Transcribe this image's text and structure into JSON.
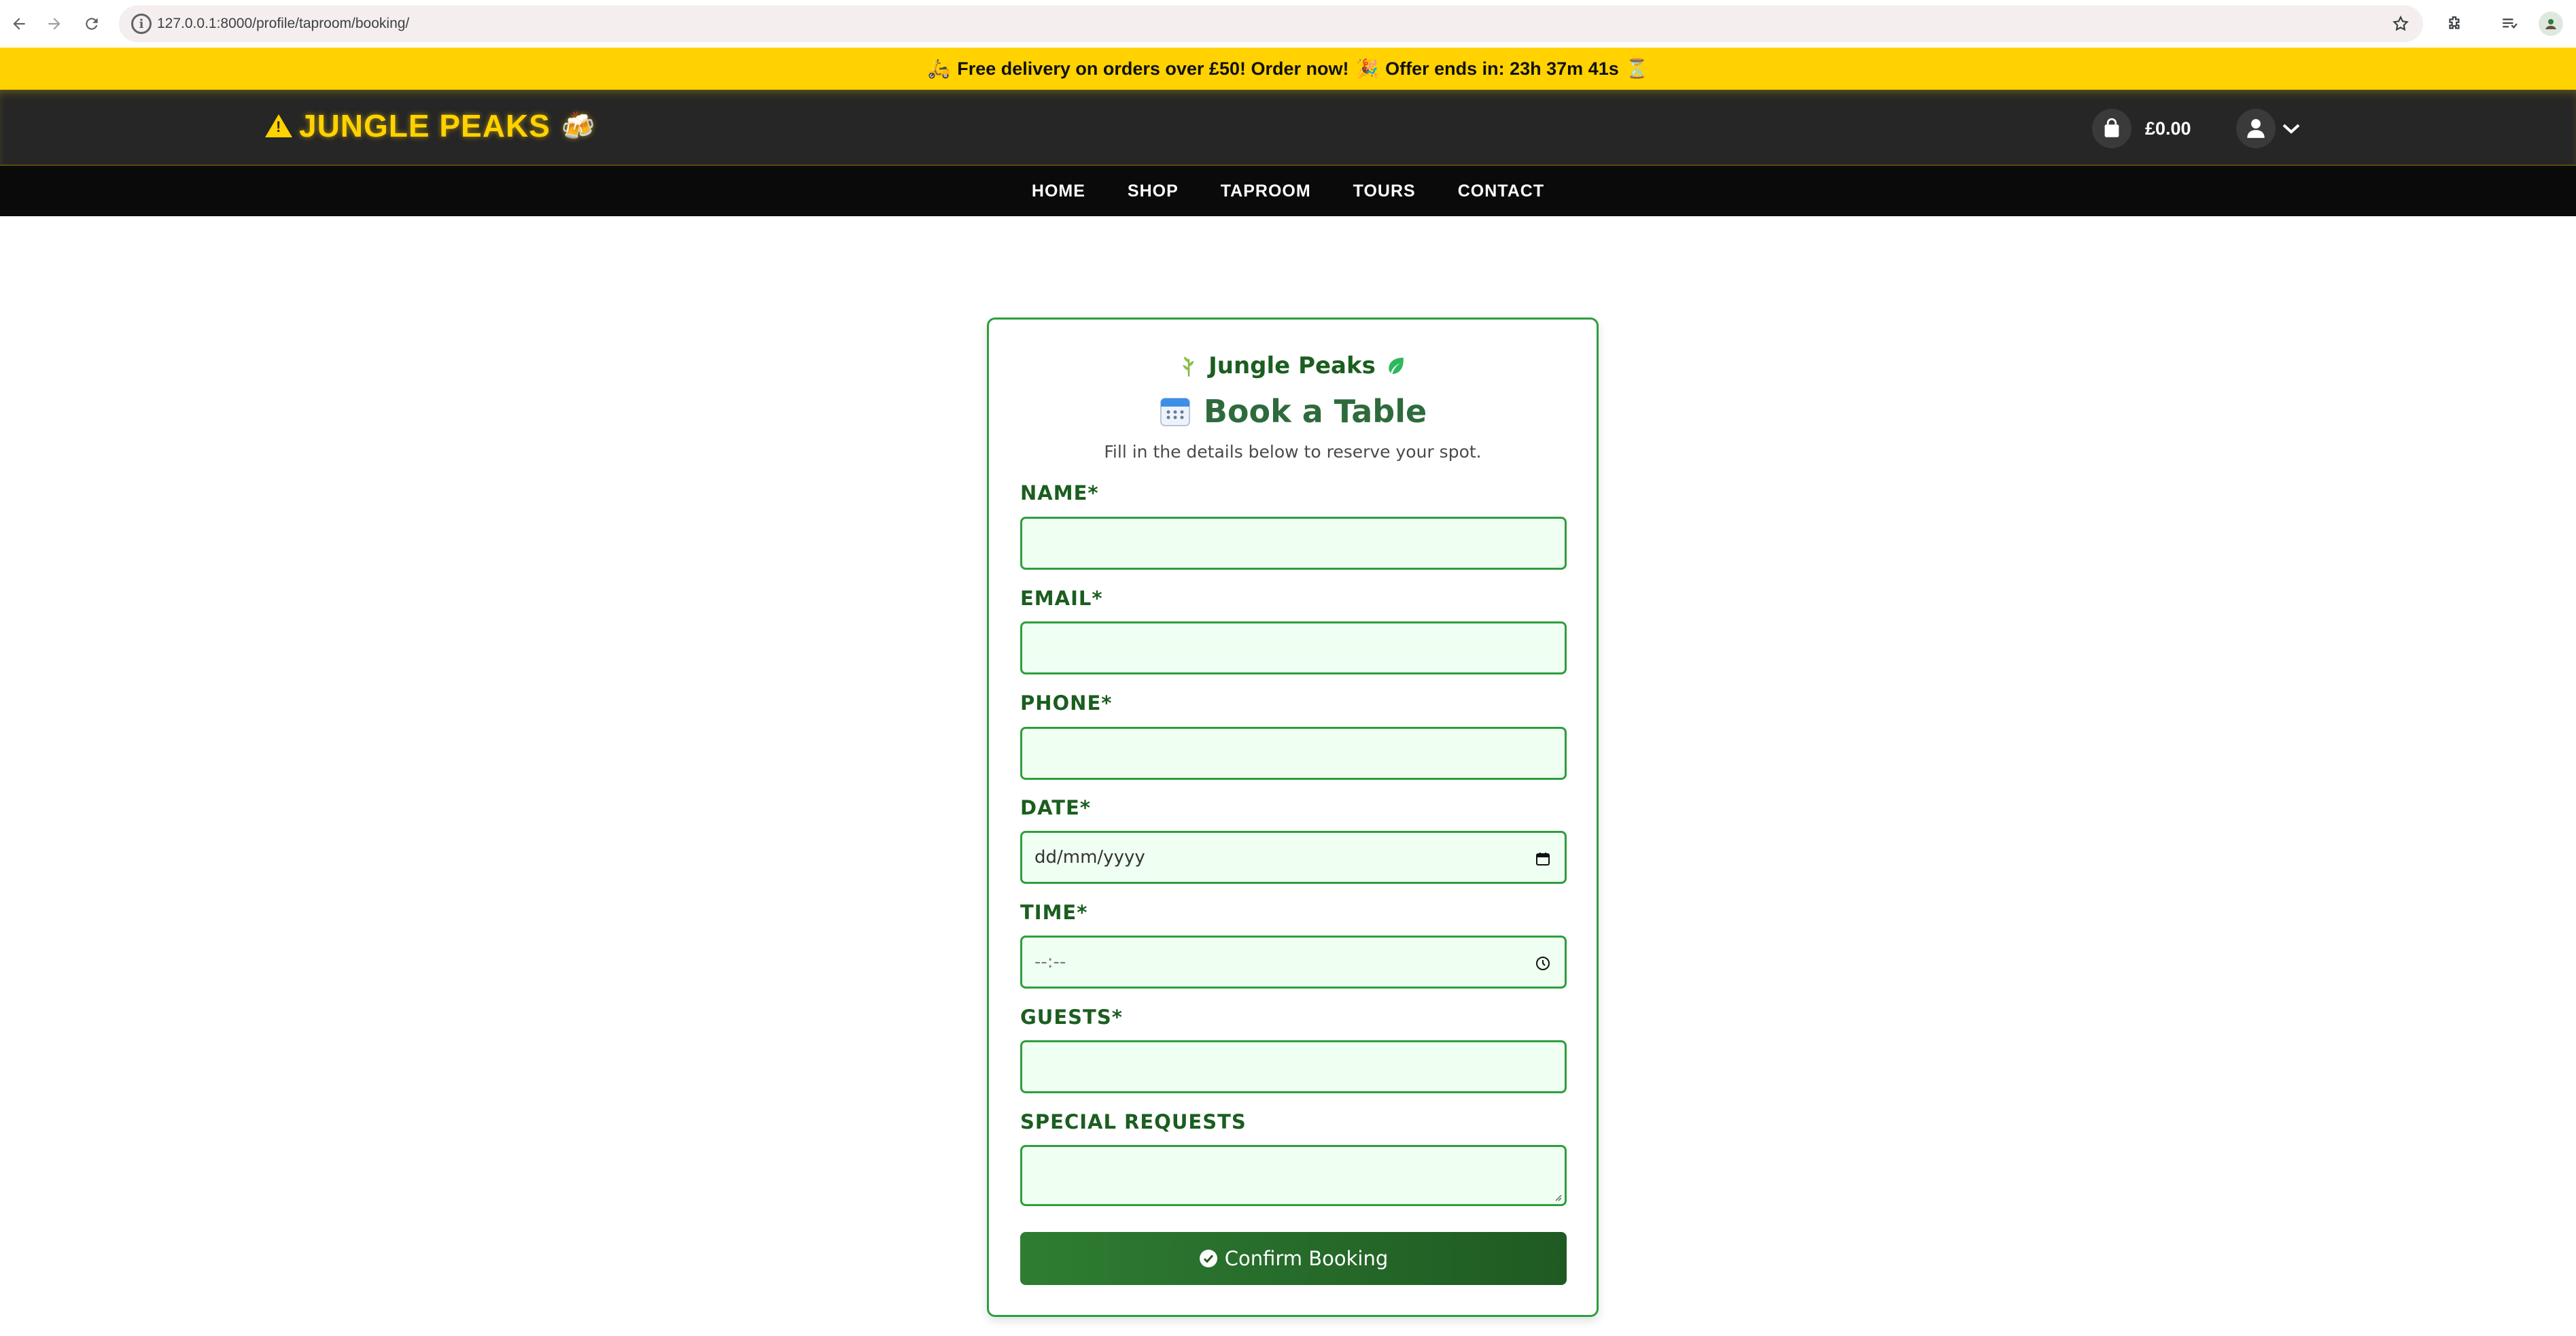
{
  "browser": {
    "url": "127.0.0.1:8000/profile/taproom/booking/",
    "icons": [
      "back-icon",
      "forward-icon",
      "reload-icon",
      "site-info-icon",
      "bookmark-star-icon",
      "extensions-icon",
      "reading-list-icon",
      "profile-icon"
    ]
  },
  "promo": {
    "icon_left": "🛵",
    "text_main": "Free delivery on orders over £50! Order now!",
    "icon_mid": "🎉",
    "text_offer": "Offer ends in: 23h 37m 41s",
    "icon_right": "⏳"
  },
  "header": {
    "logo_text": "JUNGLE PEAKS",
    "logo_icons": [
      "warning-triangle-icon",
      "beer-mugs-icon"
    ],
    "beer_glyph": "🍻",
    "cart_total": "£0.00",
    "icons": [
      "shopping-bag-icon",
      "user-icon",
      "chevron-down-icon"
    ]
  },
  "nav": {
    "items": [
      "HOME",
      "SHOP",
      "TAPROOM",
      "TOURS",
      "CONTACT"
    ]
  },
  "booking": {
    "brand": "Jungle Peaks",
    "title": "Book a Table",
    "subtitle": "Fill in the details below to reserve your spot.",
    "fields": {
      "name": {
        "label": "NAME*",
        "value": ""
      },
      "email": {
        "label": "EMAIL*",
        "value": ""
      },
      "phone": {
        "label": "PHONE*",
        "value": ""
      },
      "date": {
        "label": "DATE*",
        "placeholder": "dd/mm/yyyy"
      },
      "time": {
        "label": "TIME*",
        "placeholder": "--:--"
      },
      "guests": {
        "label": "GUESTS*",
        "value": ""
      },
      "special": {
        "label": "SPECIAL REQUESTS",
        "value": ""
      }
    },
    "submit_label": "Confirm Booking",
    "colors": {
      "accent": "#2e9e3e",
      "label": "#1b5e20",
      "field_bg": "#effff1",
      "button": "#2e7d32"
    }
  }
}
